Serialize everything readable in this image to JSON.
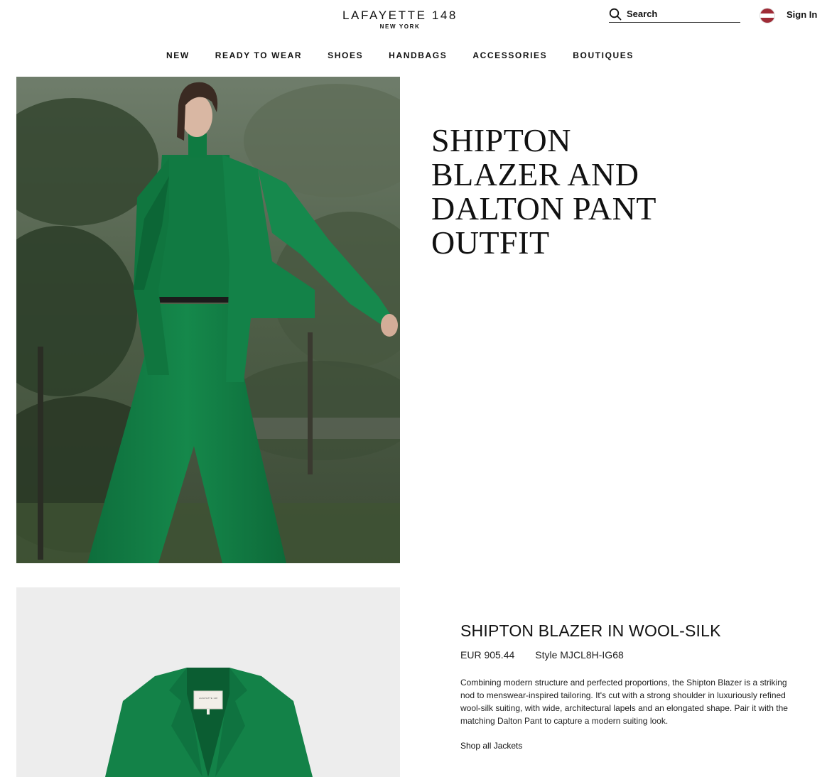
{
  "header": {
    "logo_main": "LAFAYETTE 148",
    "logo_sub": "NEW YORK",
    "search_placeholder": "Search",
    "sign_in": "Sign In"
  },
  "nav": {
    "items": [
      "NEW",
      "READY TO WEAR",
      "SHOES",
      "HANDBAGS",
      "ACCESSORIES",
      "BOUTIQUES"
    ]
  },
  "hero": {
    "title": "SHIPTON BLAZER AND DALTON PANT OUTFIT"
  },
  "product": {
    "name": "SHIPTON BLAZER IN WOOL-SILK",
    "price": "EUR 905.44",
    "style": "Style MJCL8H-IG68",
    "description": "Combining modern structure and perfected proportions, the Shipton Blazer is a striking nod to menswear-inspired tailoring. It's cut with a strong shoulder in luxuriously refined wool-silk suiting, with wide, architectural lapels and an elongated shape. Pair it with the matching Dalton Pant to capture a modern suiting look.",
    "shop_link": "Shop all Jackets",
    "label_text": "LAFAYETTE 148"
  },
  "colors": {
    "garment_green": "#12824a",
    "flag_red": "#9e2b36"
  }
}
